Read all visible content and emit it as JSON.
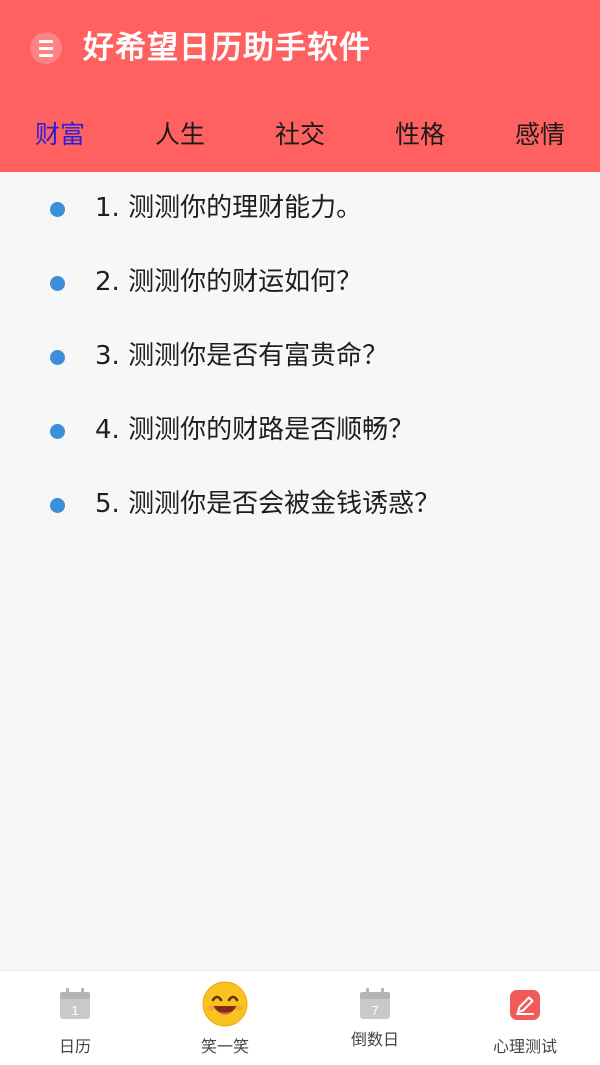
{
  "header": {
    "title": "好希望日历助手软件",
    "menu_icon": "menu-icon",
    "background": "#ff6161"
  },
  "tabs": [
    {
      "label": "财富",
      "active": true
    },
    {
      "label": "人生",
      "active": false
    },
    {
      "label": "社交",
      "active": false
    },
    {
      "label": "性格",
      "active": false
    },
    {
      "label": "感情",
      "active": false
    }
  ],
  "accent": {
    "active_tab": "#2a1fd6",
    "bullet": "#3b8fd9"
  },
  "list": [
    "1. 测测你的理财能力。",
    "2. 测测你的财运如何？",
    "3. 测测你是否有富贵命？",
    "4. 测测你的财路是否顺畅？",
    "5. 测测你是否会被金钱诱惑？"
  ],
  "bottom_nav": [
    {
      "label": "日历",
      "icon": "calendar-icon",
      "badge": "1"
    },
    {
      "label": "笑一笑",
      "icon": "smile-icon"
    },
    {
      "label": "倒数日",
      "icon": "countdown-calendar-icon",
      "badge": "7"
    },
    {
      "label": "心理测试",
      "icon": "edit-icon"
    }
  ]
}
